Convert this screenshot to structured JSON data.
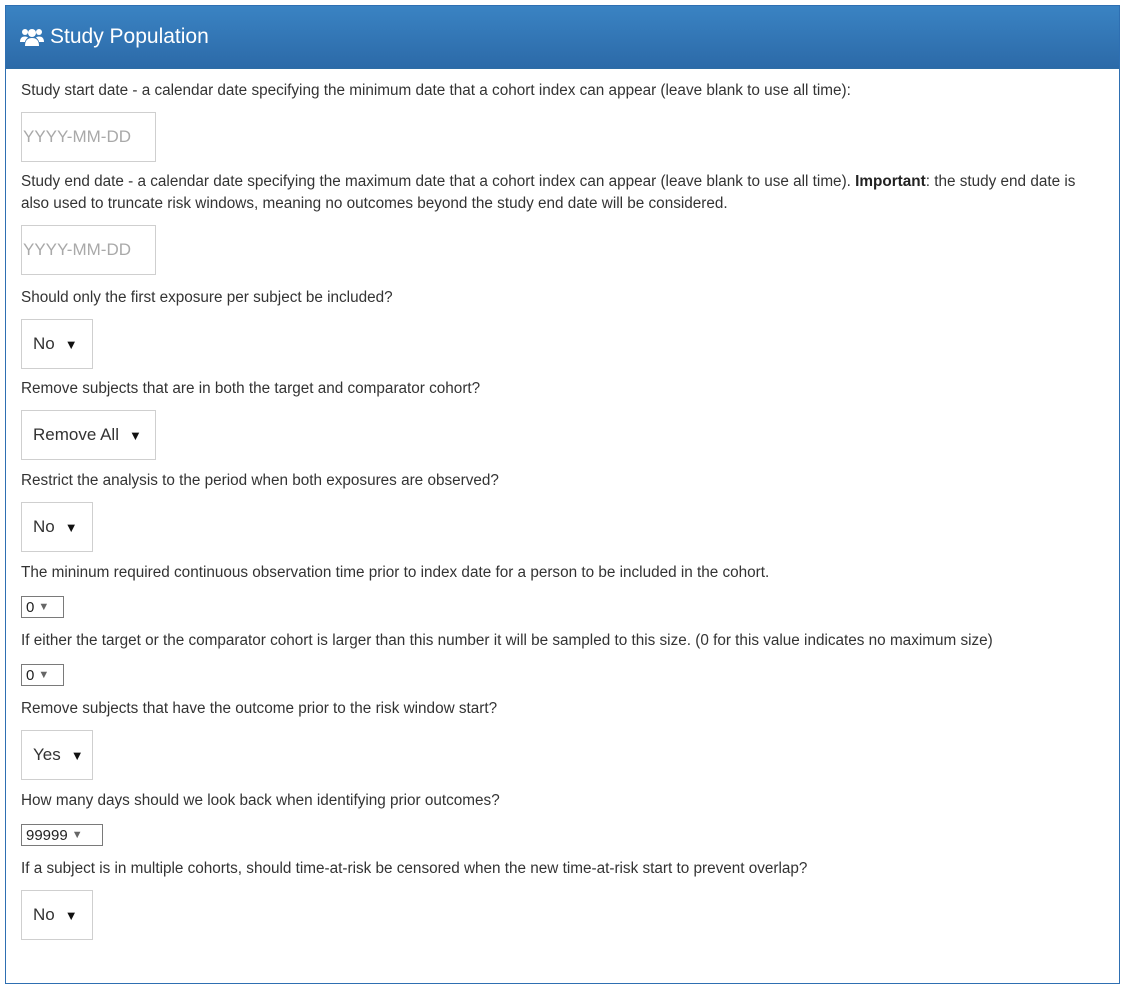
{
  "panel": {
    "title": "Study Population",
    "icon": "users-icon"
  },
  "fields": {
    "start_date": {
      "label": "Study start date - a calendar date specifying the minimum date that a cohort index can appear (leave blank to use all time):",
      "placeholder": "YYYY-MM-DD",
      "value": ""
    },
    "end_date": {
      "label_pre": "Study end date - a calendar date specifying the maximum date that a cohort index can appear (leave blank to use all time). ",
      "label_bold": "Important",
      "label_post": ": the study end date is also used to truncate risk windows, meaning no outcomes beyond the study end date will be considered.",
      "placeholder": "YYYY-MM-DD",
      "value": ""
    },
    "first_exposure": {
      "label": "Should only the first exposure per subject be included?",
      "value": "No"
    },
    "remove_both": {
      "label": "Remove subjects that are in both the target and comparator cohort?",
      "value": "Remove All"
    },
    "restrict_period": {
      "label": "Restrict the analysis to the period when both exposures are observed?",
      "value": "No"
    },
    "min_obs": {
      "label": "The mininum required continuous observation time prior to index date for a person to be included in the cohort.",
      "value": "0"
    },
    "max_size": {
      "label": "If either the target or the comparator cohort is larger than this number it will be sampled to this size. (0 for this value indicates no maximum size)",
      "value": "0"
    },
    "remove_prior": {
      "label": "Remove subjects that have the outcome prior to the risk window start?",
      "value": "Yes"
    },
    "lookback": {
      "label": "How many days should we look back when identifying prior outcomes?",
      "value": "99999"
    },
    "censor": {
      "label": "If a subject is in multiple cohorts, should time-at-risk be censored when the new time-at-risk start to prevent overlap?",
      "value": "No"
    }
  },
  "icons": {
    "dropdown": "caret-down-icon"
  },
  "colors": {
    "header": "#337ab7",
    "header_text": "#ffffff"
  }
}
